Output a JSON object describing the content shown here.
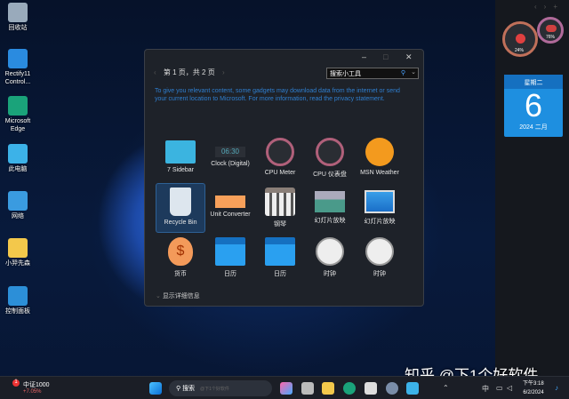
{
  "desktop_icons": [
    {
      "label": "回收站",
      "color": "#9ab"
    },
    {
      "label": "Rectify11 Control...",
      "color": "#2a8be0"
    },
    {
      "label": "Microsoft Edge",
      "color": "#1aa37a"
    },
    {
      "label": "此电脑",
      "color": "#3cb2e8"
    },
    {
      "label": "网络",
      "color": "#3a9be0"
    },
    {
      "label": "小羿先森",
      "color": "#f3c84b"
    },
    {
      "label": "控制面板",
      "color": "#2c8fd8"
    }
  ],
  "window": {
    "minimize": "–",
    "maximize": "□",
    "close": "✕",
    "prev": "‹",
    "page_label": "第 1 页，共 2 页",
    "next": "›",
    "search_value": "搜索小工具",
    "notice": "To give you relevant content, some gadgets may download data from the internet or send your current location to Microsoft. For more information, read the privacy statement.",
    "gadgets": [
      {
        "label": "7 Sidebar",
        "icon": "sidebar-icon"
      },
      {
        "label": "Clock (Digital)",
        "icon": "digital-clock-icon",
        "text": "06:30"
      },
      {
        "label": "CPU Meter",
        "icon": "cpu-meter-icon"
      },
      {
        "label": "CPU 仪表盘",
        "icon": "cpu-meter-icon"
      },
      {
        "label": "MSN Weather",
        "icon": "weather-icon"
      },
      {
        "label": "Recycle Bin",
        "icon": "recycle-bin-icon",
        "selected": true
      },
      {
        "label": "Unit Converter",
        "icon": "ruler-icon"
      },
      {
        "label": "钢琴",
        "icon": "piano-icon"
      },
      {
        "label": "幻灯片放映",
        "icon": "photo-icon"
      },
      {
        "label": "幻灯片放映",
        "icon": "picture-icon"
      },
      {
        "label": "货币",
        "icon": "money-bag-icon",
        "text": "$"
      },
      {
        "label": "日历",
        "icon": "calendar-icon"
      },
      {
        "label": "日历",
        "icon": "calendar-icon"
      },
      {
        "label": "时钟",
        "icon": "clock-icon"
      },
      {
        "label": "时钟",
        "icon": "clock-icon"
      }
    ],
    "details": "显示详细信息"
  },
  "sidebar": {
    "nav": [
      "‹",
      "›",
      "+"
    ],
    "cpu_pct": "24%",
    "mem_pct": "76%",
    "weekday": "星期二",
    "day": "6",
    "year_month": "2024 二月"
  },
  "taskbar": {
    "stock_name": "中证1000",
    "stock_change": "+7.05%",
    "badge": "1",
    "search_label": "搜索",
    "search_hint": "@下1个好软件",
    "ime": "中",
    "time": "下午3:18",
    "date": "6/2/2024"
  },
  "watermark": "知乎 @下1个好软件"
}
